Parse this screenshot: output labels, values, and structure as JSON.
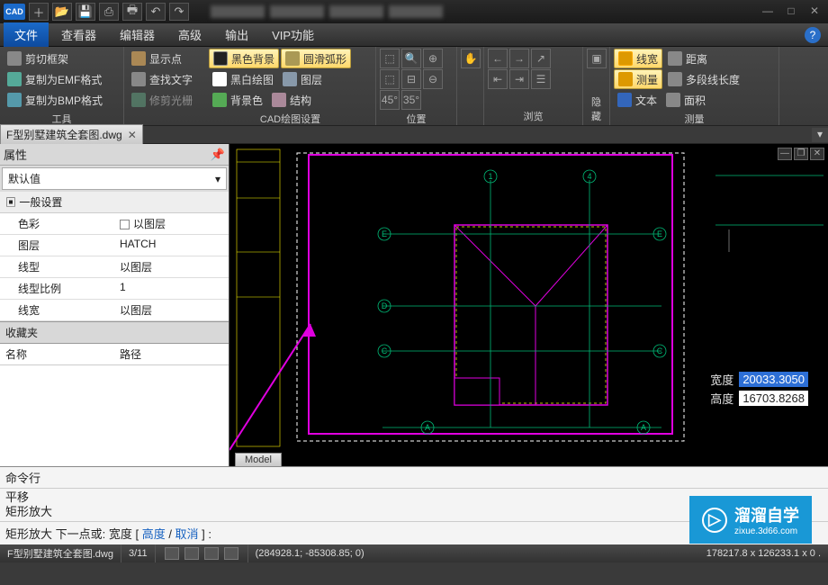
{
  "titlebar": {
    "logo": "CAD"
  },
  "menu": {
    "tabs": [
      "文件",
      "查看器",
      "编辑器",
      "高级",
      "输出",
      "VIP功能"
    ],
    "active": 0
  },
  "ribbon": {
    "panel_tools": {
      "title": "工具",
      "clip": "剪切框架",
      "emf": "复制为EMF格式",
      "bmp": "复制为BMP格式",
      "show": "显示点",
      "find": "查找文字",
      "trim": "修剪光栅"
    },
    "panel_cad": {
      "title": "CAD绘图设置",
      "bgblack": "黑色背景",
      "bw": "黑白绘图",
      "bgcolor": "背景色",
      "arc": "圆滑弧形",
      "layer": "图层",
      "struct": "结构"
    },
    "panel_pos": {
      "title": "位置"
    },
    "panel_browse": {
      "title": "浏览"
    },
    "panel_hide": {
      "title": "隐藏"
    },
    "panel_meas": {
      "title": "测量",
      "linew": "线宽",
      "meas": "测量",
      "text": "文本",
      "dist": "距离",
      "poly": "多段线长度",
      "area": "面积"
    }
  },
  "filetab": {
    "name": "F型别墅建筑全套图.dwg"
  },
  "properties": {
    "title": "属性",
    "default": "默认值",
    "section": "一般设置",
    "rows": {
      "color": {
        "label": "色彩",
        "value": "以图层"
      },
      "layer": {
        "label": "图层",
        "value": "HATCH"
      },
      "ltype": {
        "label": "线型",
        "value": "以图层"
      },
      "lscale": {
        "label": "线型比例",
        "value": "1"
      },
      "lwid": {
        "label": "线宽",
        "value": "以图层"
      }
    }
  },
  "favorites": {
    "title": "收藏夹",
    "col1": "名称",
    "col2": "路径"
  },
  "drawing": {
    "modeltab": "Model",
    "dim": {
      "width_label": "宽度",
      "width_value": "20033.3050",
      "height_label": "高度",
      "height_value": "16703.8268"
    },
    "grid_labels": {
      "top1": "1",
      "top4": "4",
      "e": "E",
      "d": "D",
      "c": "C",
      "a": "A"
    }
  },
  "command": {
    "title": "命令行",
    "history": [
      "平移",
      "矩形放大"
    ],
    "prompt_prefix": "矩形放大 下一点或: 宽度",
    "link_h": "高度",
    "link_c": "取消"
  },
  "status": {
    "file": "F型别墅建筑全套图.dwg",
    "page": "3/11",
    "coords": "(284928.1; -85308.85; 0)",
    "right": "178217.8 x 126233.1 x 0 ."
  },
  "watermark": {
    "text": "溜溜自学",
    "sub": "zixue.3d66.com"
  }
}
